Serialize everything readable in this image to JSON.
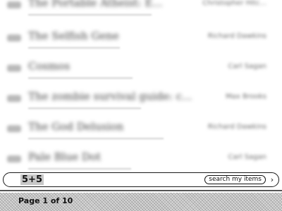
{
  "list": {
    "items": [
      {
        "title": "The Portable Atheist: E...",
        "author": "Christopher Hitc..."
      },
      {
        "title": "The Selfish Gene",
        "author": "Richard Dawkins"
      },
      {
        "title": "Cosmos",
        "author": "Carl Sagan"
      },
      {
        "title": "The zombie survival guide: c...",
        "author": "Max Brooks"
      },
      {
        "title": "The God Delusion",
        "author": "Richard Dawkins"
      },
      {
        "title": "Pale Blue Dot",
        "author": "Carl Sagan"
      }
    ]
  },
  "search": {
    "query": "5+5",
    "scope_label": "search my items",
    "arrow_glyph": "›"
  },
  "status": {
    "page_label": "Page 1 of 10"
  }
}
